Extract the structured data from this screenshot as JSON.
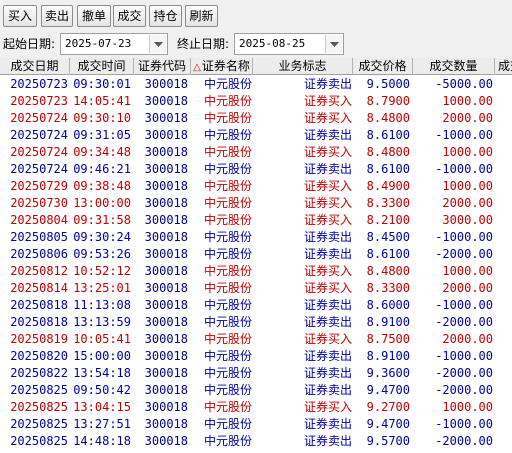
{
  "toolbar": {
    "buttons": [
      {
        "label": "买入"
      },
      {
        "label": "卖出"
      },
      {
        "label": "撤单"
      },
      {
        "label": "成交"
      },
      {
        "label": "持仓"
      },
      {
        "label": "刷新"
      }
    ]
  },
  "filters": {
    "start_label": "起始日期:",
    "start_value": "2025-07-23",
    "end_label": "终止日期:",
    "end_value": "2025-08-25"
  },
  "table": {
    "columns": [
      "成交日期",
      "成交时间",
      "证券代码",
      "证券名称",
      "业务标志",
      "成交价格",
      "成交数量",
      "成交"
    ],
    "sort_indicator": "△",
    "colors": {
      "buy": "#c00000",
      "sell": "#0000a0",
      "code": "#000080"
    },
    "rows": [
      {
        "date": "20250723",
        "time": "09:30:01",
        "code": "300018",
        "name": "中元股份",
        "flag": "证券卖出",
        "price": "9.5000",
        "qty": "-5000.00",
        "side": "sell"
      },
      {
        "date": "20250723",
        "time": "14:05:41",
        "code": "300018",
        "name": "中元股份",
        "flag": "证券买入",
        "price": "8.7900",
        "qty": "1000.00",
        "side": "buy"
      },
      {
        "date": "20250724",
        "time": "09:30:10",
        "code": "300018",
        "name": "中元股份",
        "flag": "证券买入",
        "price": "8.4800",
        "qty": "2000.00",
        "side": "buy"
      },
      {
        "date": "20250724",
        "time": "09:31:05",
        "code": "300018",
        "name": "中元股份",
        "flag": "证券卖出",
        "price": "8.6100",
        "qty": "-1000.00",
        "side": "sell"
      },
      {
        "date": "20250724",
        "time": "09:34:48",
        "code": "300018",
        "name": "中元股份",
        "flag": "证券买入",
        "price": "8.4800",
        "qty": "1000.00",
        "side": "buy"
      },
      {
        "date": "20250724",
        "time": "09:46:21",
        "code": "300018",
        "name": "中元股份",
        "flag": "证券卖出",
        "price": "8.6100",
        "qty": "-1000.00",
        "side": "sell"
      },
      {
        "date": "20250729",
        "time": "09:38:48",
        "code": "300018",
        "name": "中元股份",
        "flag": "证券买入",
        "price": "8.4900",
        "qty": "1000.00",
        "side": "buy"
      },
      {
        "date": "20250730",
        "time": "13:00:00",
        "code": "300018",
        "name": "中元股份",
        "flag": "证券买入",
        "price": "8.3300",
        "qty": "2000.00",
        "side": "buy"
      },
      {
        "date": "20250804",
        "time": "09:31:58",
        "code": "300018",
        "name": "中元股份",
        "flag": "证券买入",
        "price": "8.2100",
        "qty": "3000.00",
        "side": "buy"
      },
      {
        "date": "20250805",
        "time": "09:30:24",
        "code": "300018",
        "name": "中元股份",
        "flag": "证券卖出",
        "price": "8.4500",
        "qty": "-1000.00",
        "side": "sell"
      },
      {
        "date": "20250806",
        "time": "09:53:26",
        "code": "300018",
        "name": "中元股份",
        "flag": "证券卖出",
        "price": "8.6100",
        "qty": "-2000.00",
        "side": "sell"
      },
      {
        "date": "20250812",
        "time": "10:52:12",
        "code": "300018",
        "name": "中元股份",
        "flag": "证券买入",
        "price": "8.4800",
        "qty": "1000.00",
        "side": "buy"
      },
      {
        "date": "20250814",
        "time": "13:25:01",
        "code": "300018",
        "name": "中元股份",
        "flag": "证券买入",
        "price": "8.3300",
        "qty": "2000.00",
        "side": "buy"
      },
      {
        "date": "20250818",
        "time": "11:13:08",
        "code": "300018",
        "name": "中元股份",
        "flag": "证券卖出",
        "price": "8.6000",
        "qty": "-1000.00",
        "side": "sell"
      },
      {
        "date": "20250818",
        "time": "13:13:59",
        "code": "300018",
        "name": "中元股份",
        "flag": "证券卖出",
        "price": "8.9100",
        "qty": "-2000.00",
        "side": "sell"
      },
      {
        "date": "20250819",
        "time": "10:05:41",
        "code": "300018",
        "name": "中元股份",
        "flag": "证券买入",
        "price": "8.7500",
        "qty": "2000.00",
        "side": "buy"
      },
      {
        "date": "20250820",
        "time": "15:00:00",
        "code": "300018",
        "name": "中元股份",
        "flag": "证券卖出",
        "price": "8.9100",
        "qty": "-1000.00",
        "side": "sell"
      },
      {
        "date": "20250822",
        "time": "13:54:18",
        "code": "300018",
        "name": "中元股份",
        "flag": "证券卖出",
        "price": "9.3600",
        "qty": "-2000.00",
        "side": "sell"
      },
      {
        "date": "20250825",
        "time": "09:50:42",
        "code": "300018",
        "name": "中元股份",
        "flag": "证券卖出",
        "price": "9.4700",
        "qty": "-2000.00",
        "side": "sell"
      },
      {
        "date": "20250825",
        "time": "13:04:15",
        "code": "300018",
        "name": "中元股份",
        "flag": "证券买入",
        "price": "9.2700",
        "qty": "1000.00",
        "side": "buy"
      },
      {
        "date": "20250825",
        "time": "13:27:51",
        "code": "300018",
        "name": "中元股份",
        "flag": "证券卖出",
        "price": "9.4700",
        "qty": "-1000.00",
        "side": "sell"
      },
      {
        "date": "20250825",
        "time": "14:48:18",
        "code": "300018",
        "name": "中元股份",
        "flag": "证券卖出",
        "price": "9.5700",
        "qty": "-2000.00",
        "side": "sell"
      }
    ]
  }
}
